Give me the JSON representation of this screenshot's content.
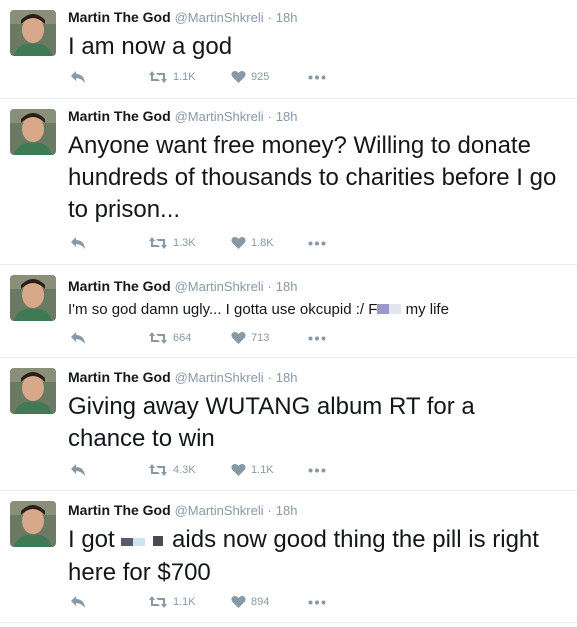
{
  "colors": {
    "muted": "#8899a6",
    "text": "#14171a",
    "divider": "#e6ecf0"
  },
  "icons": {
    "reply": "reply-icon",
    "retweet": "retweet-icon",
    "like": "heart-icon",
    "more": "more-icon"
  },
  "tweets": [
    {
      "name": "Martin The God",
      "handle": "@MartinShkreli",
      "dot": "·",
      "time": "18h",
      "text": "I am now a god",
      "retweets": "1.1K",
      "likes": "925"
    },
    {
      "name": "Martin The God",
      "handle": "@MartinShkreli",
      "dot": "·",
      "time": "18h",
      "text": "Anyone want free money? Willing to donate hundreds of thousands to charities before I go to prison...",
      "retweets": "1.3K",
      "likes": "1.8K"
    },
    {
      "name": "Martin The God",
      "handle": "@MartinShkreli",
      "dot": "·",
      "time": "18h",
      "text_before": "I'm so god damn ugly... I gotta use okcupid :/ F",
      "text_after": " my life",
      "retweets": "664",
      "likes": "713"
    },
    {
      "name": "Martin The God",
      "handle": "@MartinShkreli",
      "dot": "·",
      "time": "18h",
      "text": "Giving away WUTANG album RT for a chance to win",
      "retweets": "4.3K",
      "likes": "1.1K"
    },
    {
      "name": "Martin The God",
      "handle": "@MartinShkreli",
      "dot": "·",
      "time": "18h",
      "text_before": "I got ",
      "text_after": " aids now good thing the pill is right here for $700",
      "retweets": "1.1K",
      "likes": "894"
    }
  ]
}
